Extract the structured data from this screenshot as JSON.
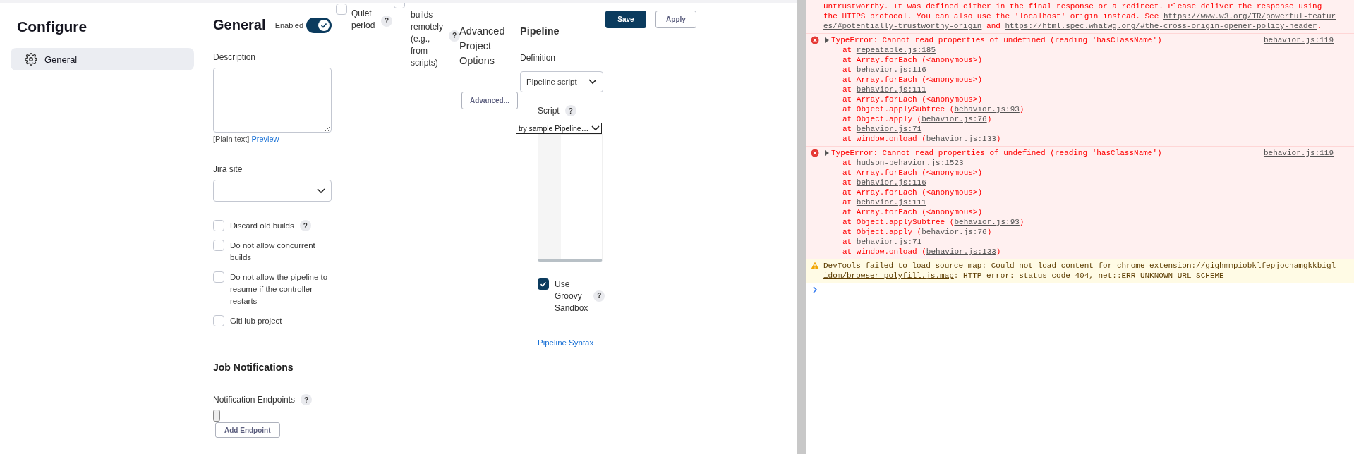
{
  "sidebar": {
    "title": "Configure",
    "items": [
      {
        "label": "General",
        "selected": true
      }
    ]
  },
  "general": {
    "heading": "General",
    "enabled": {
      "label": "Enabled",
      "on": true
    },
    "description_label": "Description",
    "format_note": "[Plain text]",
    "preview_link": "Preview",
    "jira_label": "Jira site",
    "options": [
      {
        "label": "Discard old builds",
        "checked": false,
        "help": "?"
      },
      {
        "label": "Do not allow concurrent builds",
        "checked": false
      },
      {
        "label": "Do not allow the pipeline to resume if the controller restarts",
        "checked": false
      },
      {
        "label": "GitHub project",
        "checked": false
      }
    ]
  },
  "job_notifications": {
    "heading": "Job Notifications",
    "endpoints_label": "Notification Endpoints",
    "help": "?",
    "add_button": "Add Endpoint"
  },
  "triggers": [
    {
      "label": "Quiet period",
      "checked": false,
      "help": "?"
    },
    {
      "label": "builds remotely (e.g., from scripts)",
      "checked": false,
      "help": "?"
    }
  ],
  "advanced": {
    "heading": "Advanced Project Options",
    "button": "Advanced..."
  },
  "pipeline": {
    "heading": "Pipeline",
    "definition_label": "Definition",
    "definition_value": "Pipeline script",
    "script_label": "Script",
    "script_help": "?",
    "sample_select": "try sample Pipeline…",
    "sandbox": {
      "label": "Use Groovy Sandbox",
      "checked": true,
      "help": "?"
    },
    "syntax_link": "Pipeline Syntax"
  },
  "actions": [
    {
      "label": "Save",
      "kind": "primary"
    },
    {
      "label": "Apply",
      "kind": "secondary"
    }
  ],
  "console": {
    "messages": [
      {
        "kind": "error",
        "icon": false,
        "lines": [
          [
            {
              "text": "untrustworthy. It was defined either in the final response or a redirect. Please deliver the response using"
            }
          ],
          [
            {
              "text": "the HTTPS protocol. You can also use the 'localhost' origin instead. See "
            },
            {
              "text": "https://www.w3.org/TR/powerful-featur",
              "link": true
            }
          ],
          [
            {
              "text": "es/#potentially-trustworthy-origin",
              "link": true
            },
            {
              "text": " and "
            },
            {
              "text": "https://html.spec.whatwg.org/#the-cross-origin-opener-policy-header",
              "link": true
            },
            {
              "text": "."
            }
          ]
        ]
      },
      {
        "kind": "error",
        "icon": true,
        "summary": "TypeError: Cannot read properties of undefined (reading 'hasClassName')",
        "source": "behavior.js:119",
        "stack": [
          [
            {
              "text": "at "
            },
            {
              "text": "repeatable.js:185",
              "link": true
            }
          ],
          [
            {
              "text": "at Array.forEach (<anonymous>)"
            }
          ],
          [
            {
              "text": "at "
            },
            {
              "text": "behavior.js:116",
              "link": true
            }
          ],
          [
            {
              "text": "at Array.forEach (<anonymous>)"
            }
          ],
          [
            {
              "text": "at "
            },
            {
              "text": "behavior.js:111",
              "link": true
            }
          ],
          [
            {
              "text": "at Array.forEach (<anonymous>)"
            }
          ],
          [
            {
              "text": "at Object.applySubtree ("
            },
            {
              "text": "behavior.js:93",
              "link": true
            },
            {
              "text": ")"
            }
          ],
          [
            {
              "text": "at Object.apply ("
            },
            {
              "text": "behavior.js:76",
              "link": true
            },
            {
              "text": ")"
            }
          ],
          [
            {
              "text": "at "
            },
            {
              "text": "behavior.js:71",
              "link": true
            }
          ],
          [
            {
              "text": "at window.onload ("
            },
            {
              "text": "behavior.js:133",
              "link": true
            },
            {
              "text": ")"
            }
          ]
        ]
      },
      {
        "kind": "error",
        "icon": true,
        "summary": "TypeError: Cannot read properties of undefined (reading 'hasClassName')",
        "source": "behavior.js:119",
        "stack": [
          [
            {
              "text": "at "
            },
            {
              "text": "hudson-behavior.js:1523",
              "link": true
            }
          ],
          [
            {
              "text": "at Array.forEach (<anonymous>)"
            }
          ],
          [
            {
              "text": "at "
            },
            {
              "text": "behavior.js:116",
              "link": true
            }
          ],
          [
            {
              "text": "at Array.forEach (<anonymous>)"
            }
          ],
          [
            {
              "text": "at "
            },
            {
              "text": "behavior.js:111",
              "link": true
            }
          ],
          [
            {
              "text": "at Array.forEach (<anonymous>)"
            }
          ],
          [
            {
              "text": "at Object.applySubtree ("
            },
            {
              "text": "behavior.js:93",
              "link": true
            },
            {
              "text": ")"
            }
          ],
          [
            {
              "text": "at Object.apply ("
            },
            {
              "text": "behavior.js:76",
              "link": true
            },
            {
              "text": ")"
            }
          ],
          [
            {
              "text": "at "
            },
            {
              "text": "behavior.js:71",
              "link": true
            }
          ],
          [
            {
              "text": "at window.onload ("
            },
            {
              "text": "behavior.js:133",
              "link": true
            },
            {
              "text": ")"
            }
          ]
        ]
      },
      {
        "kind": "warning",
        "icon": true,
        "lines": [
          [
            {
              "text": "DevTools failed to load source map: Could not load content for "
            },
            {
              "text": "chrome-extension://gighmmpiobklfepjocnamgkkbigl",
              "link": true
            }
          ],
          [
            {
              "text": "idom/browser-polyfill.js.map",
              "link": true
            },
            {
              "text": ": HTTP error: status code 404, net::ERR_UNKNOWN_URL_SCHEME"
            }
          ]
        ]
      }
    ]
  }
}
